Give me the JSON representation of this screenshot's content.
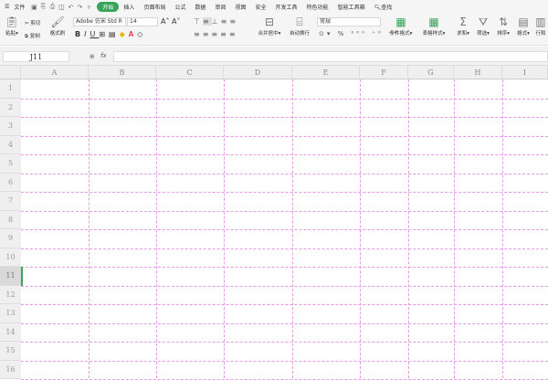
{
  "menu": {
    "file": "文件",
    "tabs": [
      "开始",
      "插入",
      "页面布局",
      "公式",
      "数据",
      "审阅",
      "视图",
      "安全",
      "开发工具",
      "特色功能",
      "智能工具箱"
    ],
    "active_tab": "开始",
    "search": "查找"
  },
  "ribbon": {
    "paste": "粘贴",
    "cut": "剪切",
    "copy": "复制",
    "format_painter": "格式刷",
    "font": "Adobe 仿宋 Std R",
    "size": "14",
    "merge": "合并居中",
    "wrap": "自动换行",
    "number_format": "常规",
    "cond_format": "条件格式",
    "table_style": "表格样式",
    "sum": "求和",
    "filter": "筛选",
    "sort": "排序",
    "format": "格式",
    "rowcol": "行和"
  },
  "formula_bar": {
    "cell_ref": "J11",
    "fx": "fx",
    "value": ""
  },
  "sheet": {
    "columns": [
      "A",
      "B",
      "C",
      "D",
      "E",
      "F",
      "G",
      "H",
      "I"
    ],
    "rows": [
      "1",
      "2",
      "3",
      "4",
      "5",
      "6",
      "7",
      "8",
      "9",
      "10",
      "11",
      "12",
      "13",
      "14",
      "15",
      "16"
    ],
    "selected_row": "11",
    "grid_color": "#e69ae6",
    "accent": "#3aa35a"
  }
}
